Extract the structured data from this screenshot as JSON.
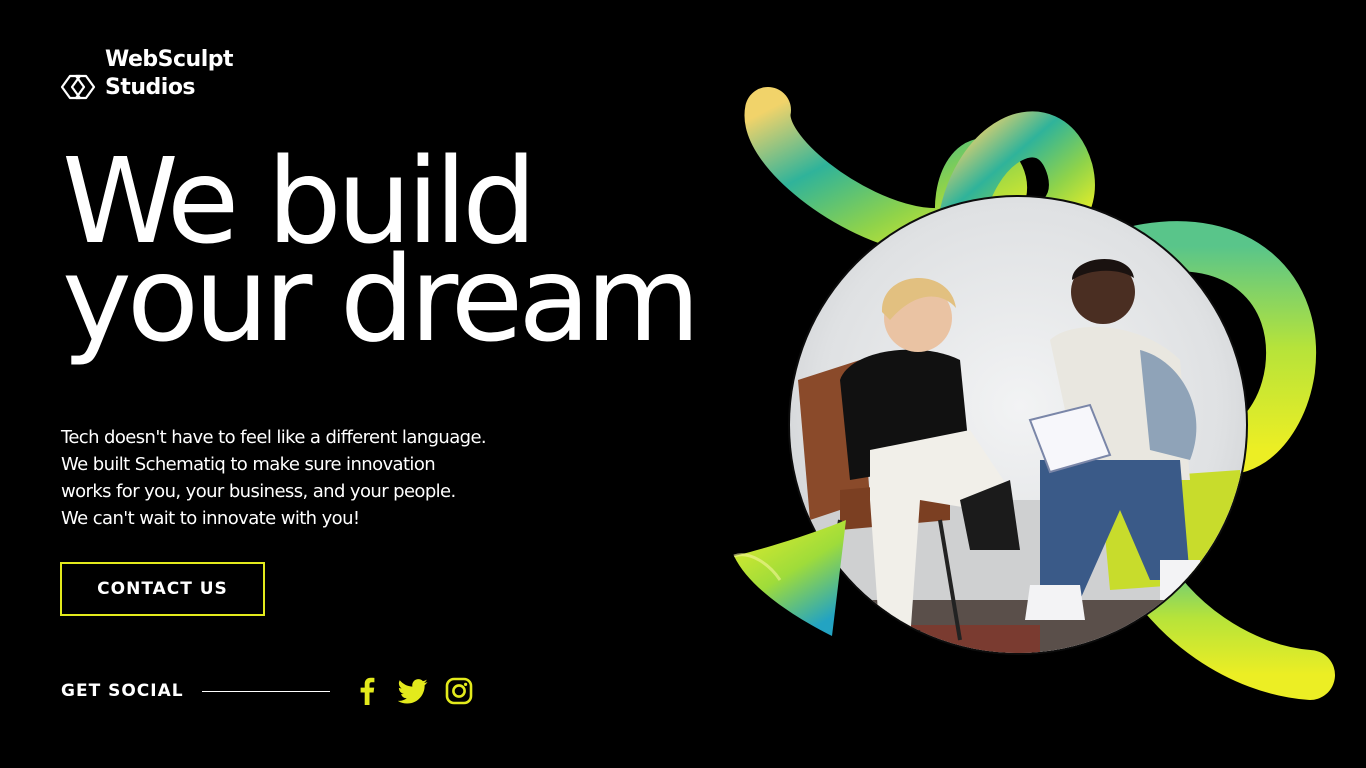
{
  "brand": {
    "name_line1": "WebSculpt",
    "name_line2": "Studios",
    "logo_icon": "diamond-knot-icon"
  },
  "hero": {
    "headline_line1": "We build",
    "headline_line2": "your dream",
    "intro_lines": [
      "Tech doesn't have to feel like a different language.",
      "We built Schematiq to make sure innovation",
      "works for you, your business, and your people.",
      "We can't wait to innovate with you!"
    ],
    "contact_label": "CONTACT US",
    "photo_description_icon": "people-photo"
  },
  "social": {
    "label": "GET SOCIAL",
    "icons": [
      "facebook-icon",
      "twitter-icon",
      "instagram-icon"
    ]
  },
  "colors": {
    "background": "#000000",
    "text": "#ffffff",
    "accent": "#e3ea1c",
    "gradient_teal": "#2fb39a",
    "gradient_lime": "#d9ee2a",
    "gradient_yellow": "#f1d36a"
  }
}
